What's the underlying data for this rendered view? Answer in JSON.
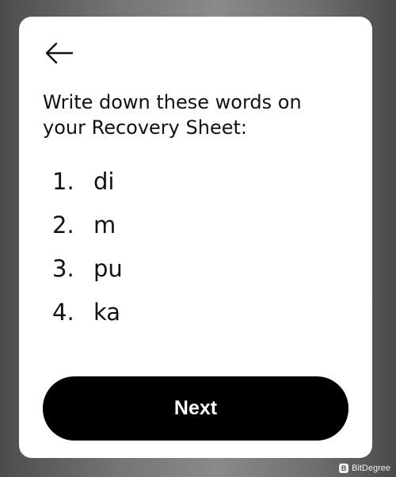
{
  "screen": {
    "back_icon": "arrow-left-icon",
    "instruction": "Write down these words on your Recovery Sheet:",
    "words": [
      {
        "number": "1.",
        "word": "di"
      },
      {
        "number": "2.",
        "word": "m"
      },
      {
        "number": "3.",
        "word": "pu"
      },
      {
        "number": "4.",
        "word": "ka"
      }
    ],
    "next_label": "Next"
  },
  "watermark": {
    "text": "BitDegree"
  },
  "colors": {
    "card": "#ffffff",
    "button": "#000000",
    "button_text": "#ffffff",
    "text": "#111111"
  }
}
